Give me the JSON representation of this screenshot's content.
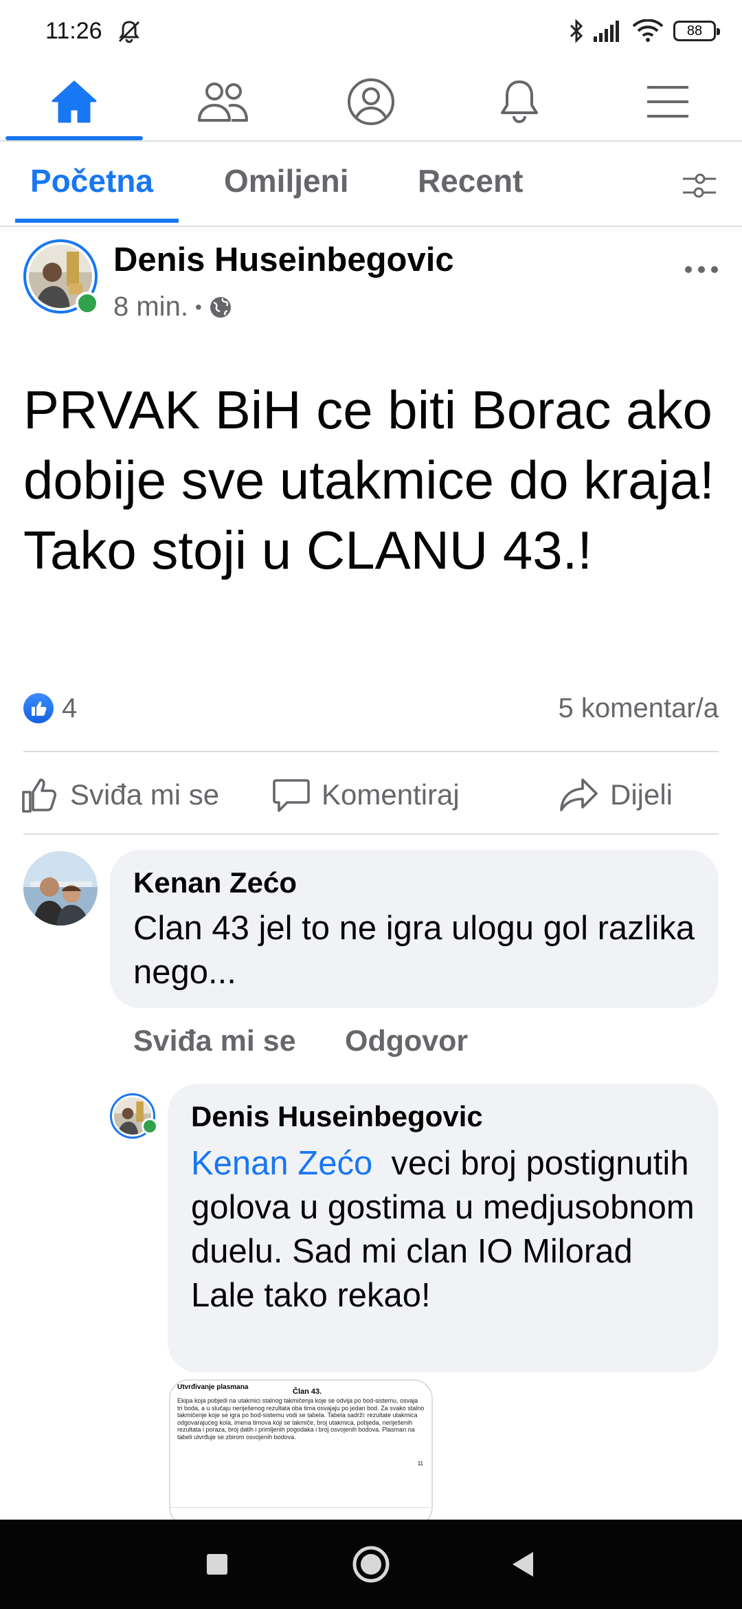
{
  "status_bar": {
    "time": "11:26",
    "battery": "88",
    "icons": [
      "mute-bell-icon",
      "bluetooth-icon",
      "signal-icon",
      "wifi-icon",
      "battery-icon"
    ]
  },
  "top_nav": {
    "items": [
      "home-icon",
      "friends-icon",
      "profile-icon",
      "notifications-icon",
      "menu-icon"
    ],
    "active": "home-icon",
    "accent": "#1877f2"
  },
  "feed_tabs": {
    "items": [
      {
        "label": "Početna",
        "active": true
      },
      {
        "label": "Omiljeni",
        "active": false
      },
      {
        "label": "Recent",
        "active": false
      }
    ]
  },
  "post": {
    "author": "Denis Huseinbegovic",
    "time": "8 min.",
    "separator": "•",
    "privacy_icon": "globe-icon",
    "text": "PRVAK BiH ce biti Borac ako dobije sve utakmice do kraja! Tako stoji u CLANU 43.!",
    "likes": "4",
    "comments": "5 komentar/a",
    "actions": {
      "like": "Sviđa mi se",
      "comment": "Komentiraj",
      "share": "Dijeli"
    }
  },
  "comments": [
    {
      "author": "Kenan Zećo",
      "text": "Clan 43 jel to ne igra ulogu gol razlika nego...",
      "actions": {
        "like": "Sviđa mi se",
        "reply": "Odgovor"
      }
    }
  ],
  "reply": {
    "author": "Denis Huseinbegovic",
    "mention": "Kenan Zećo",
    "text": "veci broj postignutih golova u gostima u medjusobnom duelu. Sad mi clan IO Milorad Lale tako rekao!",
    "attachment": {
      "heading": "Utvrđivanje plasmana",
      "title": "Član 43.",
      "body": "Ekipa koja pobjedi na utakmici stalnog takmičenja koje se odvija po bod-sistemu, osvaja tri boda, a u slučaju neriješenog rezultata oba tima osvajaju po jedan bod. Za svako stalno takmičenje koje se igra po bod-sistemu vodi se tabela. Tabela sadrži: rezultate utakmica odgovarajućeg kola, imena timova koji se takmiče, broj utakmica, pobjeda, neriješenih rezultata i poraza, broj datih i primljenih pogodaka i broj osvojenih bodova. Plasman na tabeli utvrđuje se zbirom osvojenih bodova.",
      "page": "11"
    }
  },
  "nav_bar": {
    "items": [
      "recents-button",
      "home-button",
      "back-button"
    ]
  }
}
